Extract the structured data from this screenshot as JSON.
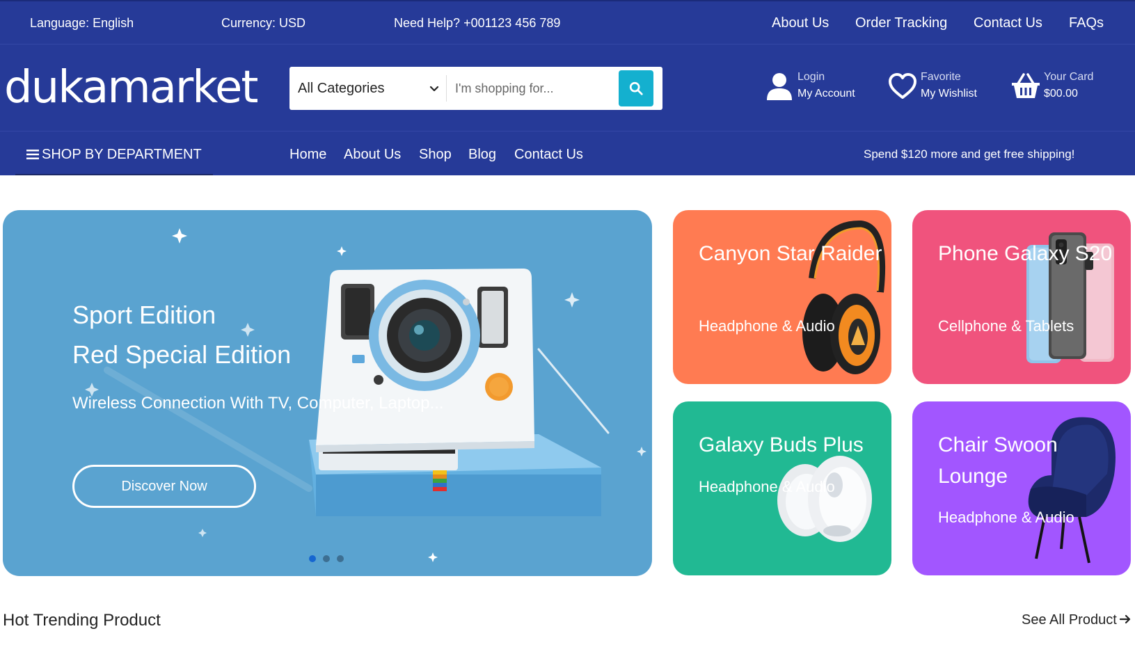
{
  "topbar": {
    "language": "Language: English",
    "currency": "Currency: USD",
    "help": "Need Help? +001123 456 789",
    "links": [
      "About Us",
      "Order Tracking",
      "Contact Us",
      "FAQs"
    ]
  },
  "header": {
    "logo": "dukamarket",
    "search": {
      "category": "All Categories",
      "placeholder": "I'm shopping for..."
    },
    "account": {
      "line1": "Login",
      "line2": "My Account",
      "icon": "user-icon"
    },
    "wishlist": {
      "line1": "Favorite",
      "line2": "My Wishlist",
      "icon": "heart-icon"
    },
    "cart": {
      "line1": "Your Card",
      "line2": "$00.00",
      "icon": "basket-icon"
    }
  },
  "nav": {
    "department": "SHOP BY DEPARTMENT",
    "links": [
      "Home",
      "About Us",
      "Shop",
      "Blog",
      "Contact Us"
    ],
    "promo": "Spend $120 more and get free shipping!"
  },
  "hero": {
    "line1": "Sport Edition",
    "line2": "Red Special Edition",
    "subtitle": "Wireless Connection With TV, Computer, Laptop...",
    "cta": "Discover Now",
    "slides": 3,
    "active_slide": 1
  },
  "cards": [
    {
      "title": "Canyon Star Raider",
      "category": "Headphone & Audio",
      "color": "#ff7b52"
    },
    {
      "title": "Phone Galaxy S20",
      "category": "Cellphone & Tablets",
      "color": "#f0537d"
    },
    {
      "title": "Galaxy Buds Plus",
      "category": "Headphone & Audio",
      "color": "#21b993"
    },
    {
      "title": "Chair Swoon Lounge",
      "category": "Headphone & Audio",
      "color": "#a256ff"
    }
  ],
  "section": {
    "title": "Hot Trending Product",
    "see_all": "See All Product"
  },
  "colors": {
    "header_bg": "#263a98",
    "search_button": "#14b0cf",
    "hero_bg": "#5aa3d0"
  }
}
